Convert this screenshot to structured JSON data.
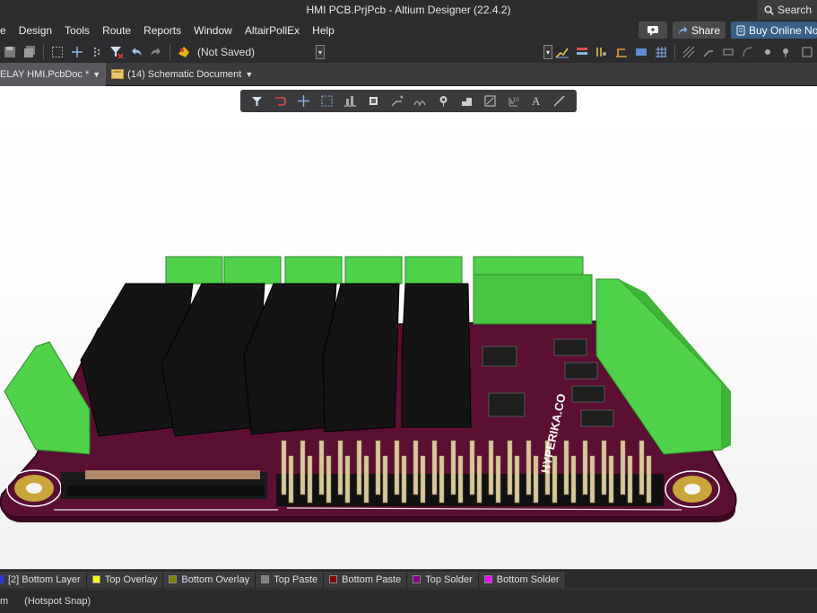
{
  "window": {
    "title": "HMI PCB.PrjPcb - Altium Designer (22.4.2)",
    "search_label": "Search"
  },
  "menubar": {
    "items": [
      "e",
      "Design",
      "Tools",
      "Route",
      "Reports",
      "Window",
      "AltairPollEx",
      "Help"
    ],
    "share_label": "Share",
    "buy_label": "Buy Online Now"
  },
  "toolbar": {
    "save_state": "(Not Saved)"
  },
  "tabs": [
    {
      "label": "ELAY HMI.PcbDoc *"
    },
    {
      "label": "(14) Schematic Document"
    }
  ],
  "board": {
    "silkscreen_text": "HYPERIKA.CO"
  },
  "layers": [
    {
      "label": "[2] Bottom Layer",
      "color": "#2a3fd6"
    },
    {
      "label": "Top Overlay",
      "color": "#ffff00"
    },
    {
      "label": "Bottom Overlay",
      "color": "#808000"
    },
    {
      "label": "Top Paste",
      "color": "#808080"
    },
    {
      "label": "Bottom Paste",
      "color": "#800000"
    },
    {
      "label": "Top Solder",
      "color": "#800080"
    },
    {
      "label": "Bottom Solder",
      "color": "#ff00ff"
    }
  ],
  "status": {
    "left": "m",
    "snap": "(Hotspot Snap)"
  },
  "colors": {
    "pcb": "#5a0f33",
    "connector": "#4fd14a",
    "relay": "#141414",
    "pin": "#d8c79a",
    "accent": "#3a5f86"
  }
}
